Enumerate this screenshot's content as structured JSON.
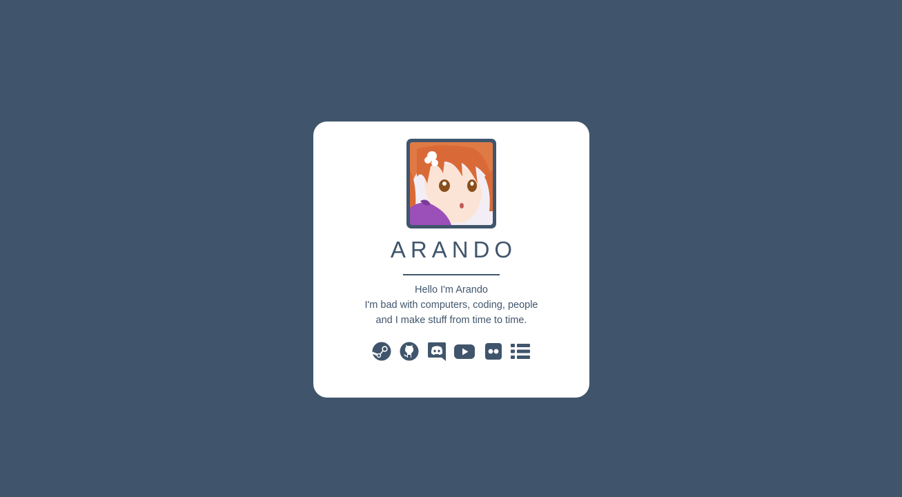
{
  "profile": {
    "name": "ARANDO",
    "bio_lines": [
      "Hello I'm Arando",
      "I'm bad with computers, coding, people",
      "and I make stuff from time to time."
    ],
    "avatar": "anime-girl-avatar"
  },
  "social_links": [
    {
      "icon": "steam-icon"
    },
    {
      "icon": "github-icon"
    },
    {
      "icon": "discord-icon"
    },
    {
      "icon": "youtube-icon"
    },
    {
      "icon": "flickr-icon"
    },
    {
      "icon": "list-icon"
    }
  ],
  "colors": {
    "background": "#40556c",
    "card": "#ffffff",
    "accent": "#40556c"
  }
}
